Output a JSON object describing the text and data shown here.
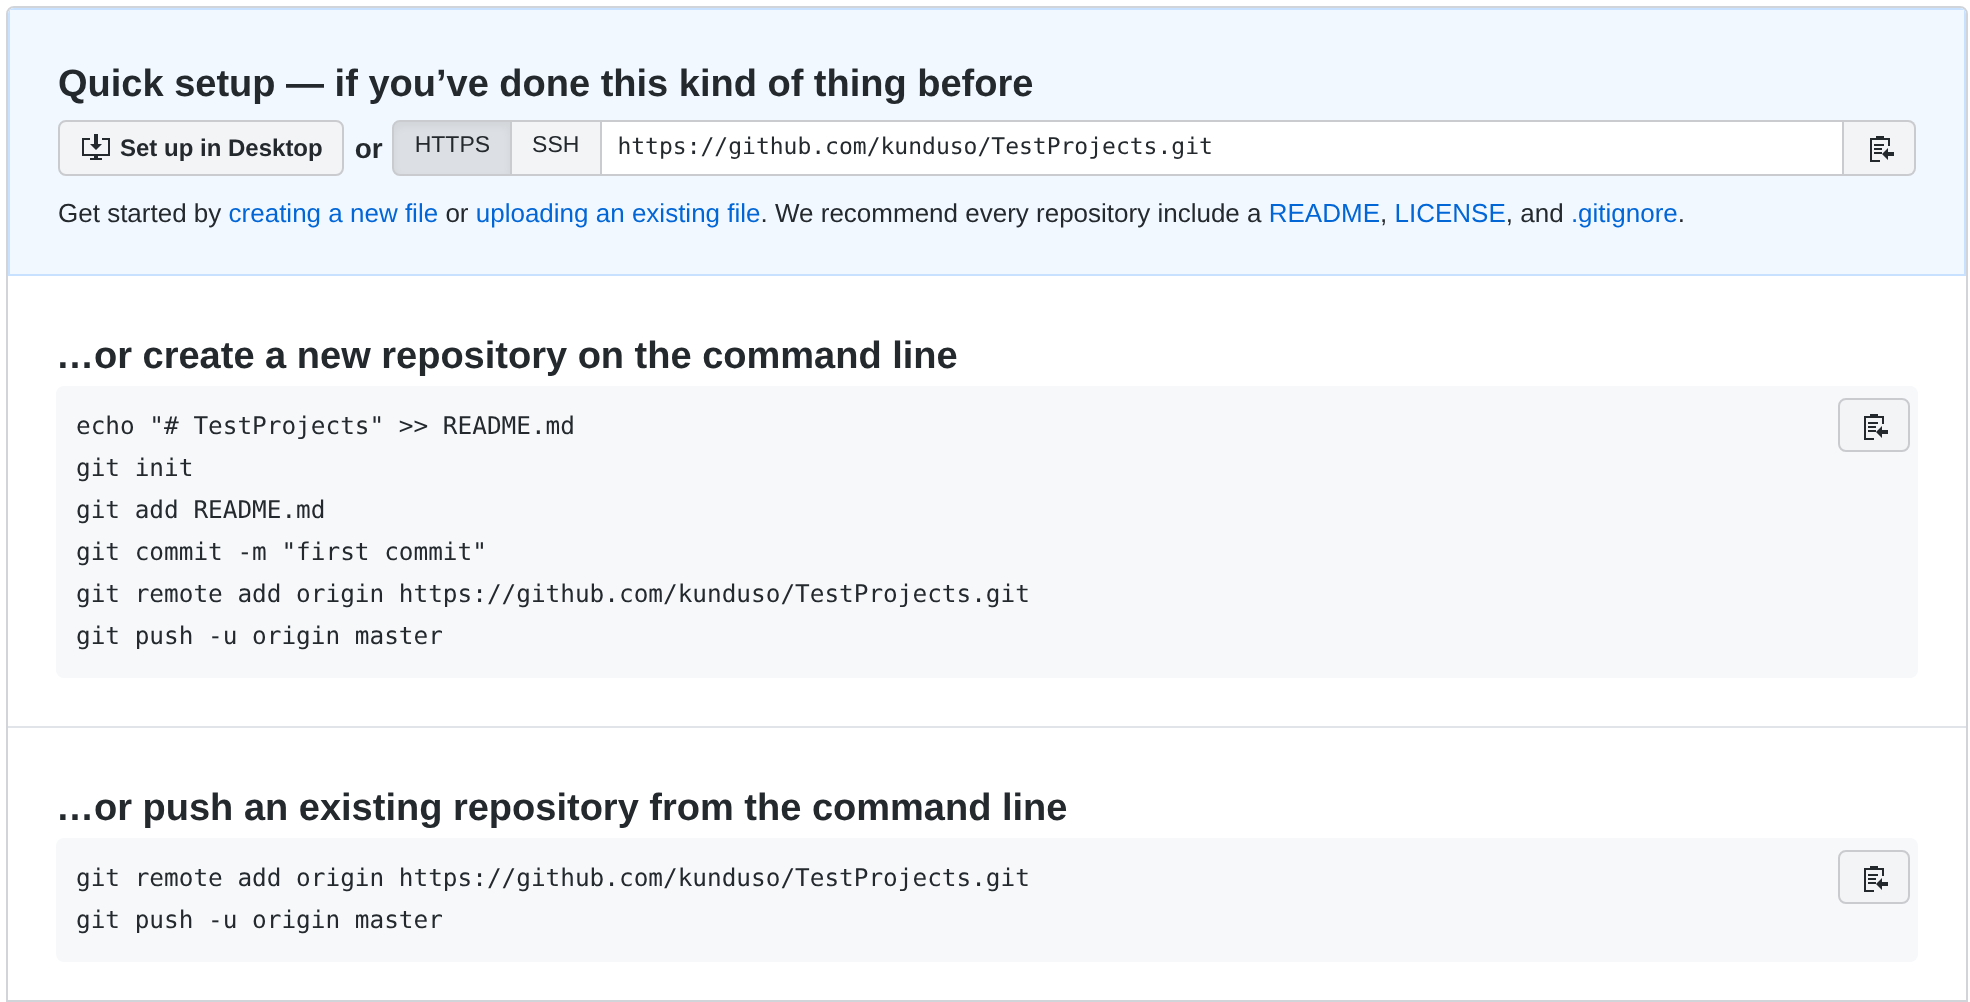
{
  "quick_setup": {
    "title": "Quick setup — if you’ve done this kind of thing before",
    "desktop_button": "Set up in Desktop",
    "or": "or",
    "protocols": [
      {
        "label": "HTTPS",
        "selected": true
      },
      {
        "label": "SSH",
        "selected": false
      }
    ],
    "url": "https://github.com/kunduso/TestProjects.git",
    "intro": [
      {
        "kind": "text",
        "text": "Get started by"
      },
      {
        "kind": "link",
        "text": "creating a new file"
      },
      {
        "kind": "text",
        "text": "or"
      },
      {
        "kind": "link",
        "text": "uploading an existing file"
      },
      {
        "kind": "text",
        "text": ". We recommend every repository include a"
      },
      {
        "kind": "link",
        "text": "README"
      },
      {
        "kind": "text",
        "text": ","
      },
      {
        "kind": "link",
        "text": "LICENSE"
      },
      {
        "kind": "text",
        "text": ", and"
      },
      {
        "kind": "link",
        "text": ".gitignore"
      },
      {
        "kind": "text",
        "text": "."
      }
    ]
  },
  "sections": [
    {
      "title": "…or create a new repository on the command line",
      "code": [
        "echo \"# TestProjects\" >> README.md",
        "git init",
        "git add README.md",
        "git commit -m \"first commit\"",
        "git remote add origin https://github.com/kunduso/TestProjects.git",
        "git push -u origin master"
      ]
    },
    {
      "title": "…or push an existing repository from the command line",
      "code": [
        "git remote add origin https://github.com/kunduso/TestProjects.git",
        "git push -u origin master"
      ]
    }
  ]
}
